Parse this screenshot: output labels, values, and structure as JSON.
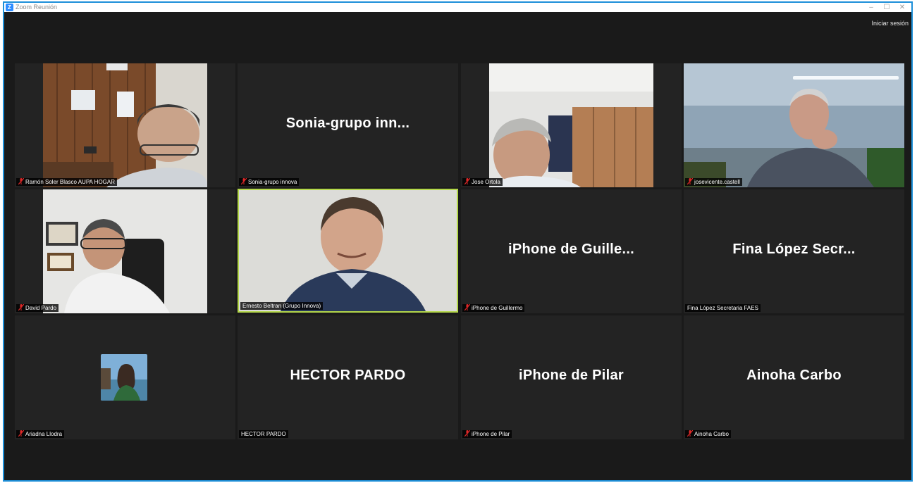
{
  "window": {
    "title": "Zoom Reunión",
    "controls": {
      "minimize": "–",
      "maximize": "☐",
      "close": "✕"
    },
    "accent_color": "#1c8fd9"
  },
  "header": {
    "signin_label": "Iniciar sesión"
  },
  "participants": [
    {
      "label": "Ramón Soler Blasco AUPA HOGAR",
      "muted": true,
      "video": true
    },
    {
      "display_name": "Sonia-grupo inn...",
      "label": "Sonia-grupo innova",
      "muted": true,
      "video": false
    },
    {
      "label": "Jose Ortola",
      "muted": true,
      "video": true
    },
    {
      "label": "josevicente.castell",
      "muted": true,
      "video": true
    },
    {
      "label": "David Pardo",
      "muted": true,
      "video": true
    },
    {
      "label": "Ernesto Beltran (Grupo Innova)",
      "muted": false,
      "video": true,
      "active_speaker": true
    },
    {
      "display_name": "iPhone de Guille...",
      "label": "iPhone de Guillermo",
      "muted": true,
      "video": false
    },
    {
      "display_name": "Fina López Secr...",
      "label": "Fina López Secretaria FAES",
      "muted": false,
      "video": false
    },
    {
      "label": "Ariadna Llodra",
      "muted": true,
      "video": false,
      "avatar": true
    },
    {
      "display_name": "HECTOR PARDO",
      "label": "HECTOR PARDO",
      "muted": false,
      "video": false
    },
    {
      "display_name": "iPhone de Pilar",
      "label": "iPhone de Pilar",
      "muted": true,
      "video": false
    },
    {
      "display_name": "Ainoha Carbo",
      "label": "Ainoha Carbo",
      "muted": true,
      "video": false
    }
  ],
  "colors": {
    "mic_muted": "#e02828",
    "active_speaker_border": "#b4d84a"
  }
}
